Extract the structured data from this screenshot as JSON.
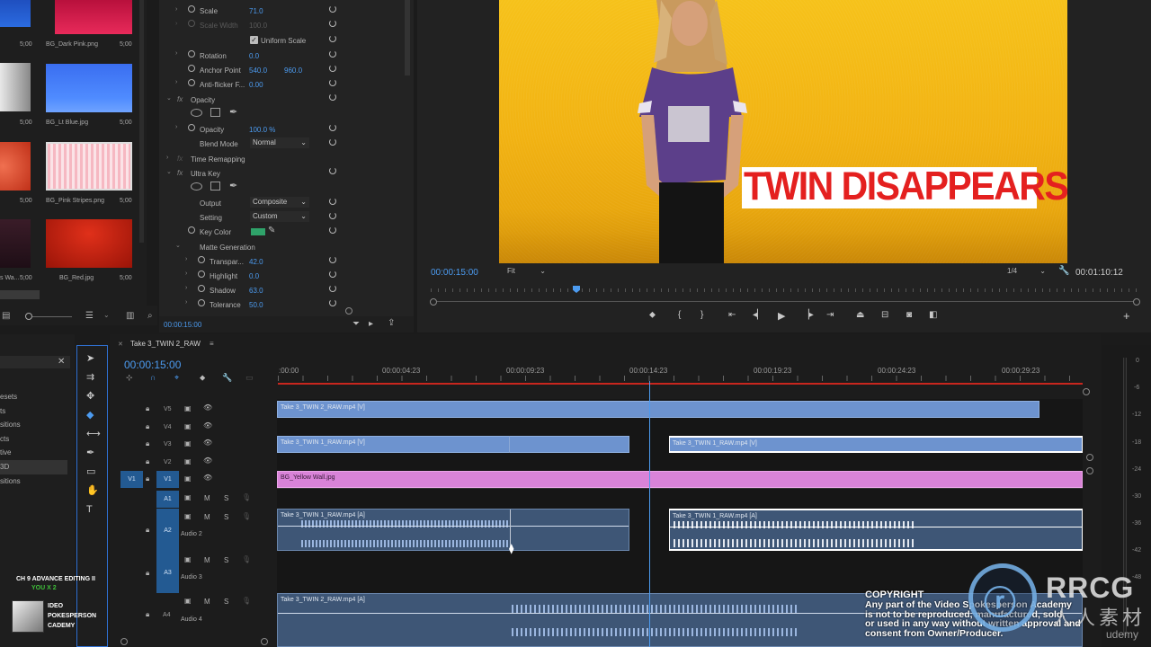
{
  "project": {
    "thumbs": [
      {
        "label": "BG_Dark Pink.png",
        "dur": "5;00"
      },
      {
        "label": "BG_Lt Blue.jpg",
        "dur": "5;00"
      },
      {
        "label": "BG_Pink Stripes.png",
        "dur": "5;00"
      },
      {
        "label": "BG_Red.jpg",
        "dur": "5;00"
      }
    ],
    "left_durs": [
      "5;00",
      "5;00",
      "5;00",
      "5;00"
    ],
    "left_label": "s Wa...",
    "effects_list": [
      "esets",
      "ts",
      "sitions",
      "cts",
      "tive",
      "3D",
      "sitions"
    ]
  },
  "effect_controls": {
    "scale_label": "Scale",
    "scale_value": "71.0",
    "scale_width_label": "Scale Width",
    "scale_width_value": "100.0",
    "uniform_scale": "Uniform Scale",
    "rotation_label": "Rotation",
    "rotation_value": "0.0",
    "anchor_label": "Anchor Point",
    "anchor_x": "540.0",
    "anchor_y": "960.0",
    "antiflicker_label": "Anti-flicker F...",
    "antiflicker_value": "0.00",
    "opacity_section": "Opacity",
    "opacity_label": "Opacity",
    "opacity_value": "100.0 %",
    "blend_label": "Blend Mode",
    "blend_value": "Normal",
    "time_remap": "Time Remapping",
    "ultra_key": "Ultra Key",
    "output_label": "Output",
    "output_value": "Composite",
    "setting_label": "Setting",
    "setting_value": "Custom",
    "key_color_label": "Key Color",
    "matte_gen": "Matte Generation",
    "transp_label": "Transpar...",
    "transp_value": "42.0",
    "highlight_label": "Highlight",
    "highlight_value": "0.0",
    "shadow_label": "Shadow",
    "shadow_value": "63.0",
    "tolerance_label": "Tolerance",
    "tolerance_value": "50.0",
    "timecode": "00:00:15:00",
    "fx_symbol": "fx"
  },
  "monitor": {
    "title_overlay": "TWIN DISAPPEARS",
    "timecode": "00:00:15:00",
    "fit": "Fit",
    "quality": "1/4",
    "duration": "00:01:10:12"
  },
  "timeline": {
    "sequence_name": "Take 3_TWIN 2_RAW",
    "timecode": "00:00:15:00",
    "ruler": [
      ":00:00",
      "00:00:04:23",
      "00:00:09:23",
      "00:00:14:23",
      "00:00:19:23",
      "00:00:24:23",
      "00:00:29:23"
    ],
    "tracks_v": [
      "V5",
      "V4",
      "V3",
      "V2",
      "V1"
    ],
    "tracks_a": [
      "A1",
      "A2",
      "A3",
      "A4"
    ],
    "audio_names": [
      "Audio 2",
      "Audio 3",
      "Audio 4"
    ],
    "source_patch_v": "V1",
    "mute": "M",
    "solo": "S",
    "clips": {
      "v5": "Take 3_TWIN 2_RAW.mp4 [V]",
      "v3a": "Take 3_TWIN 1_RAW.mp4 [V]",
      "v3b": "Take 3_TWIN 1_RAW.mp4 [V]",
      "v1": "BG_Yellow Wall.jpg",
      "a2a": "Take 3_TWIN 1_RAW.mp4 [A]",
      "a2b": "Take 3_TWIN 1_RAW.mp4 [A]",
      "a4": "Take 3_TWIN 2_RAW.mp4 [A]"
    }
  },
  "meter_scale": [
    "0",
    "-6",
    "-12",
    "-18",
    "-24",
    "-30",
    "-36",
    "-42",
    "-48"
  ],
  "watermark": {
    "course_line1": "CH 9 ADVANCE EDITING II",
    "course_line2": "YOU X 2",
    "brand_lines": [
      "IDEO",
      "POKESPERSON",
      "CADEMY"
    ],
    "copyright_title": "COPYRIGHT",
    "copyright_text": [
      "Any part of the Video Spokesperson Academy",
      "is not to be reproduced, manufactured, sold,",
      "or used in any way without written approval and",
      "consent from Owner/Producer."
    ],
    "rrcg": "RRCG",
    "rrcg_cn": "人人素材",
    "udemy": "udemy"
  }
}
